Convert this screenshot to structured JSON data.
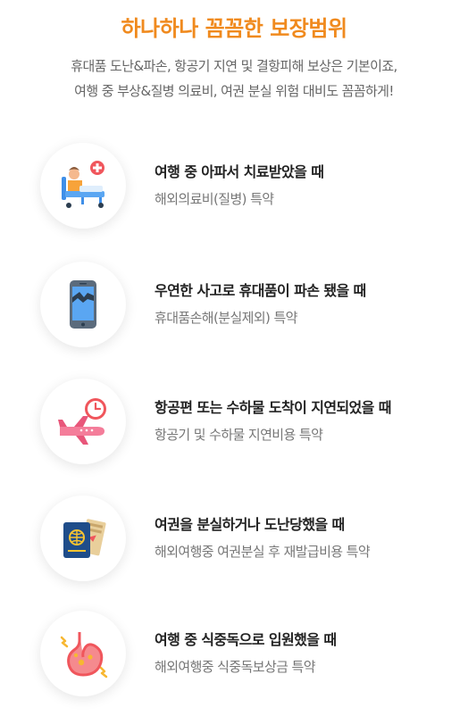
{
  "header": {
    "title": "하나하나 꼼꼼한 보장범위",
    "subtitle_line1": "휴대품 도난&파손, 항공기 지연 및 결항피해 보상은 기본이죠,",
    "subtitle_line2": "여행 중 부상&질병 의료비, 여권 분실 위험 대비도 꼼꼼하게!"
  },
  "items": [
    {
      "title": "여행 중 아파서 치료받았을 때",
      "sub": "해외의료비(질병) 특약",
      "icon": "hospital-bed-icon"
    },
    {
      "title": "우연한 사고로 휴대품이 파손 됐을 때",
      "sub": "휴대품손해(분실제외) 특약",
      "icon": "broken-phone-icon"
    },
    {
      "title": "항공편 또는 수하물 도착이 지연되었을 때",
      "sub": "항공기 및 수하물 지연비용 특약",
      "icon": "delayed-flight-icon"
    },
    {
      "title": "여권을 분실하거나 도난당했을 때",
      "sub": "해외여행중 여권분실 후 재발급비용 특약",
      "icon": "passport-icon"
    },
    {
      "title": "여행 중 식중독으로 입원했을 때",
      "sub": "해외여행중 식중독보상금 특약",
      "icon": "stomach-icon"
    }
  ],
  "colors": {
    "accent": "#f08a1e",
    "heading_text": "#222222",
    "sub_text": "#777777"
  }
}
